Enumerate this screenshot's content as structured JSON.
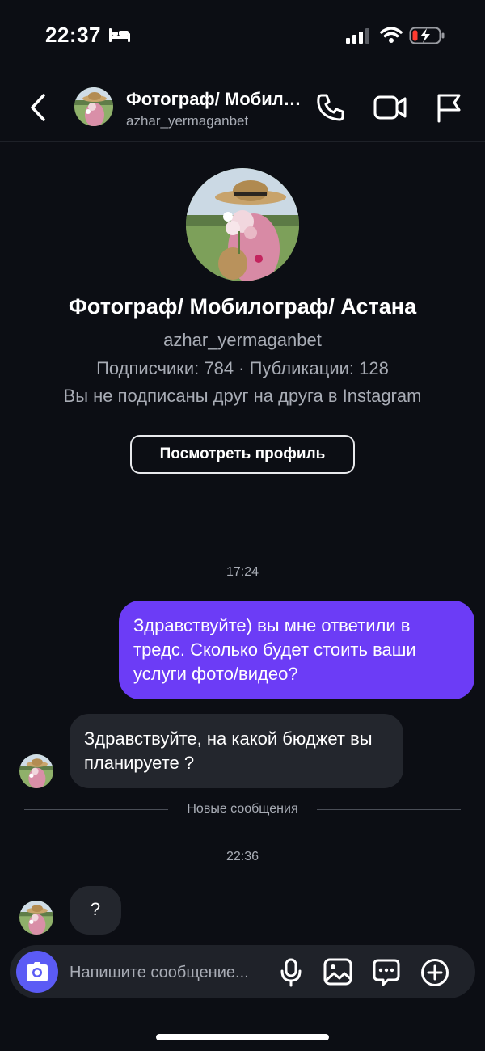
{
  "status_bar": {
    "time": "22:37"
  },
  "header": {
    "title": "Фотограф/ Мобилограф/ Астана",
    "username": "azhar_yermaganbet"
  },
  "profile": {
    "name": "Фотограф/ Мобилограф/ Астана",
    "username": "azhar_yermaganbet",
    "stats": "Подписчики: 784 · Публикации: 128",
    "note": "Вы не подписаны друг на друга в Instagram",
    "view_button": "Посмотреть профиль"
  },
  "messages": {
    "time_1": "17:24",
    "outgoing_1": "Здравствуйте) вы мне ответили в тредс. Сколько будет стоить ваши услуги фото/видео?",
    "incoming_1": "Здравствуйте, на какой бюджет вы планируете ?",
    "new_messages_label": "Новые сообщения",
    "time_2": "22:36",
    "incoming_2": "?"
  },
  "composer": {
    "placeholder": "Напишите сообщение..."
  },
  "colors": {
    "background": "#0c0e14",
    "outgoing_bubble": "#6c3cf6",
    "incoming_bubble": "#23262d",
    "camera_button": "#5b5bf5"
  }
}
